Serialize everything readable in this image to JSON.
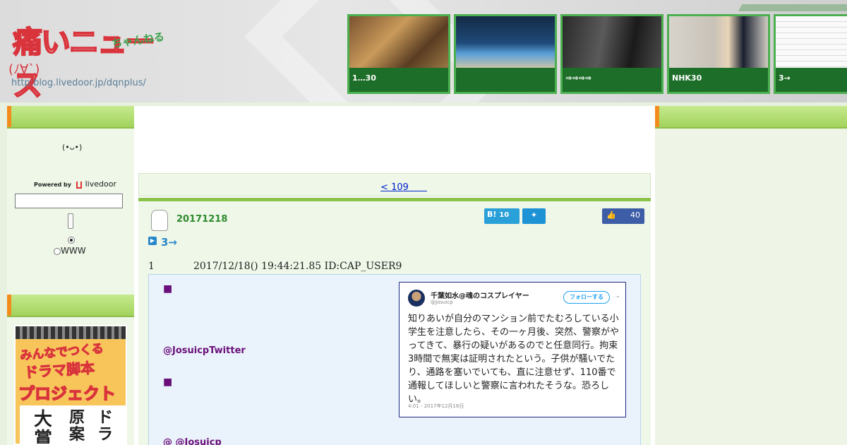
{
  "header": {
    "logo_main": "痛いニュース",
    "logo_sub": "ちゃんねる",
    "logo_face": "(ﾉ∀`)",
    "logo_url": "http:blog.livedoor.jp/dqnplus/"
  },
  "thumbnails": [
    {
      "caption": "1…30",
      "color": "#6b4a2a"
    },
    {
      "caption": "",
      "color": "#2d5d8a"
    },
    {
      "caption": "⇒⇒⇒⇒",
      "color": "#3a3a3a"
    },
    {
      "caption": "NHK30",
      "color": "#b5b0a8"
    },
    {
      "caption": "3→",
      "color": "#f2f2f2"
    }
  ],
  "sidebar": {
    "emoticon": "(•ᴗ•)",
    "powered_by": "Powered by",
    "livedoor": "livedoor",
    "search_value": "",
    "radio_www": "WWW",
    "banner": {
      "line1": "みんなでつくる",
      "line2": "ドラマ脚本",
      "line3": "プロジェクト",
      "col1": "大賞",
      "col2": "原案",
      "col3": "ドラ"
    }
  },
  "nav": {
    "prev_link": "< 109　　"
  },
  "post": {
    "date": "20171218",
    "hatena_label": "B!",
    "hatena_count": "10",
    "like_count": "40",
    "title": "3→",
    "res_number": "1",
    "res_meta": "2017/12/18() 19:44:21.85 ID:CAP_USER9",
    "bullet1": "■",
    "twitter_handle_text": "@JosuicpTwitter",
    "bullet2": "■",
    "at_josuicp": "@ @Josuicp"
  },
  "tweet": {
    "name": "千葉如水@魂のコスプレイヤー",
    "handle": "@Josuicp",
    "follow": "フォローする",
    "body": "知りあいが自分のマンション前でたむろしている小学生を注意したら、その一ヶ月後、突然、警察がやってきて、暴行の疑いがあるのでと任意同行。拘束3時間で無実は証明されたという。子供が騒いでたり、通路を塞いでいても、直に注意せず、110番で通報してほしいと警察に言われたそうな。恐ろしい。",
    "time": "4:01 - 2017年12月16日"
  },
  "colors": {
    "accent_green": "#2e8b2e",
    "link_blue": "#0022cc",
    "purple": "#6b0f7a"
  }
}
